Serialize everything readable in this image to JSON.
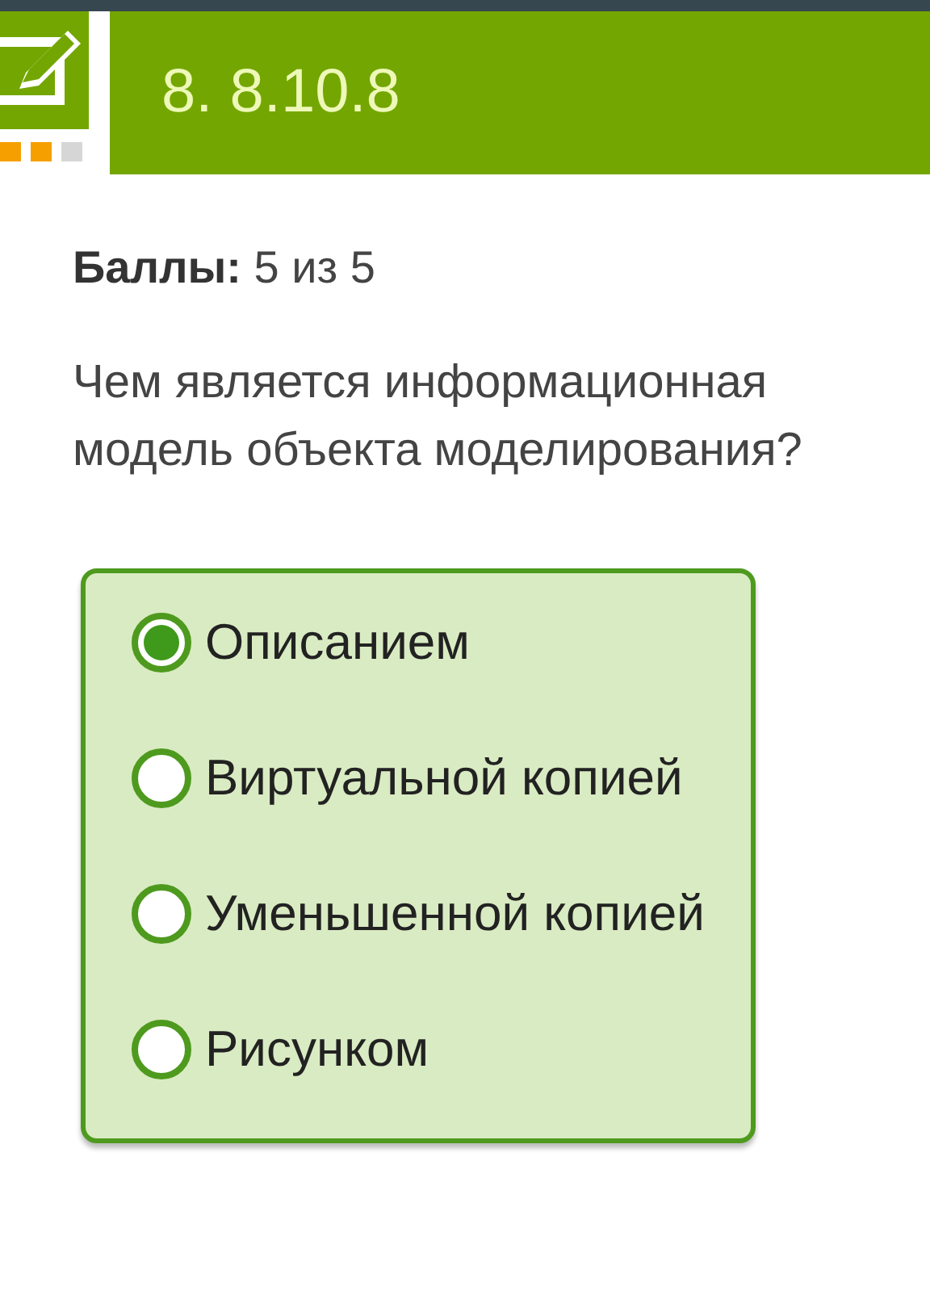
{
  "header": {
    "title": "8. 8.10.8",
    "progress": [
      {
        "done": true
      },
      {
        "done": true
      },
      {
        "done": false
      }
    ]
  },
  "score": "**Баллы:** 5 из 5",
  "question": "Чем является информационная модель объекта моделирования?",
  "options": [
    {
      "label": "Описанием",
      "selected": true
    },
    {
      "label": "Виртуальной копией",
      "selected": false
    },
    {
      "label": "Уменьшенной копией",
      "selected": false
    },
    {
      "label": "Рисунком",
      "selected": false
    }
  ]
}
